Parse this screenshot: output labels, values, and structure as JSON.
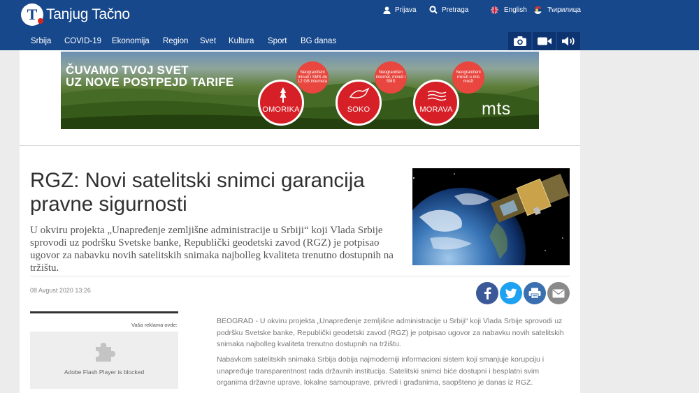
{
  "header": {
    "logo_letter": "T",
    "logo_text": "Tanjug Tačno",
    "top_links": {
      "login": "Prijava",
      "search": "Pretraga",
      "lang_en": "English",
      "lang_cyr": "Ћирилица"
    },
    "nav": [
      "Srbija",
      "COVID-19",
      "Ekonomija",
      "Region",
      "Svet",
      "Kultura",
      "Sport",
      "BG danas"
    ],
    "media_icons": [
      "camera-icon",
      "video-icon",
      "audio-icon"
    ],
    "colors": {
      "bar": "#17488c",
      "media_btn": "#0d3370"
    }
  },
  "banner": {
    "headline_line1": "ČUVAMO TVOJ SVET",
    "headline_line2": "UZ NOVE POSTPEJD TARIFE",
    "badges": [
      {
        "label": "OMORIKA",
        "bubble": "Neograničeni minuti i SMS do 12 GB interneta",
        "icon": "tree-icon"
      },
      {
        "label": "SOKO",
        "bubble": "Neograničen internet, minuti i SMS",
        "icon": "falcon-icon"
      },
      {
        "label": "MORAVA",
        "bubble": "Neograničeni minuti u mts mreži",
        "icon": "waves-icon"
      }
    ],
    "brand": "mts",
    "accent": "#d61f26"
  },
  "article": {
    "title": "RGZ: Novi satelitski snimci garancija pravne sigurnosti",
    "lead": "U okviru projekta „Unapređenje zemljišne administracije u Srbiji“ koji Vlada Srbije sprovodi uz podršku Svetske banke, Republički geodetski zavod (RGZ) je potpisao ugovor za nabavku novih satelitskih snimaka najbolleg kvaliteta trenutno dostupnih na tržištu.",
    "date": "08 Avgust 2020 13:26",
    "share": [
      {
        "name": "facebook-share-button",
        "icon": "facebook-icon",
        "color": "#3b5998"
      },
      {
        "name": "twitter-share-button",
        "icon": "twitter-icon",
        "color": "#1da1f2"
      },
      {
        "name": "print-button",
        "icon": "print-icon",
        "color": "#3a6fb0"
      },
      {
        "name": "email-share-button",
        "icon": "mail-icon",
        "color": "#8a8a8a"
      }
    ],
    "body": [
      "BEOGRAD - U okviru projekta „Unapređenje zemljišne administracije u Srbiji“ koji Vlada Srbije sprovodi uz podršku Svetske banke, Republički geodetski zavod (RGZ) je potpisao ugovor za nabavku novih satelitskih snimaka najbolleg kvaliteta trenutno dostupnih na tržištu.",
      "Nabavkom satelitskih snimaka Srbija dobija najmoderniji informacioni sistem koji smanjuje korupciju i unapređuje transparentnost rada državnih institucija. Satelitski snimci biće dostupni i besplatni svim organima državne uprave, lokalne samouprave, privredi i građanima, saopšteno je danas iz RGZ."
    ]
  },
  "sidebar_ad": {
    "label": "Vaša reklama ovde:",
    "flash_text": "Adobe Flash Player is blocked"
  }
}
